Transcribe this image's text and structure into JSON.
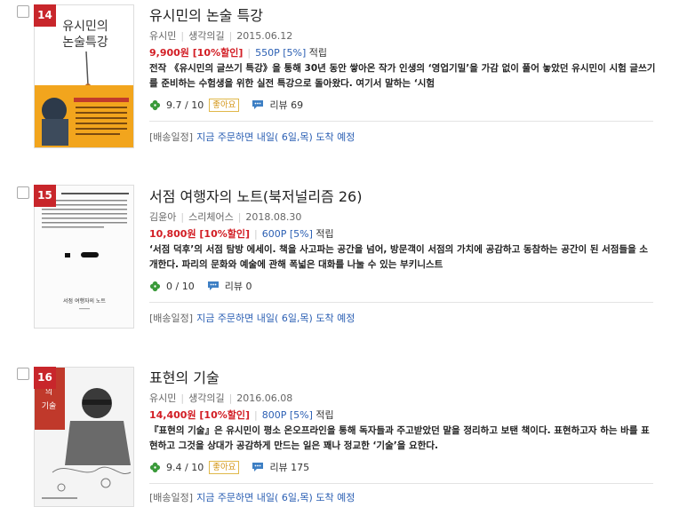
{
  "items": [
    {
      "rank": "14",
      "title": "유시민의 논술 특강",
      "author": "유시민",
      "publisher": "생각의길",
      "date": "2015.06.12",
      "price": "9,900원 [10%할인]",
      "points": "550P [5%]",
      "earn": "적립",
      "desc": "전작 《유시민의 글쓰기 특강》을 통해 30년 동안 쌓아온 작가 인생의 ‘영업기밀’을 가감 없이 풀어 놓았던 유시민이 시험 글쓰기를 준비하는 수험생을 위한 실전 특강으로 돌아왔다. 여기서 말하는 ‘시험",
      "rating": "9.7 / 10",
      "badge": "좋아요",
      "review": "리뷰 69",
      "ship_label": "[배송일정]",
      "ship_msg": "지금 주문하면 내일( 6일,목) 도착 예정",
      "cover": {
        "title": "유시민의 논술특강",
        "band": "혼자서도 할 수 있다!"
      }
    },
    {
      "rank": "15",
      "title": "서점 여행자의 노트(북저널리즘 26)",
      "author": "김윤아",
      "publisher": "스리체어스",
      "date": "2018.08.30",
      "price": "10,800원 [10%할인]",
      "points": "600P [5%]",
      "earn": "적립",
      "desc": "‘서점 덕후’의 서점 탐방 에세이. 책을 사고파는 공간을 넘어, 방문객이 서점의 가치에 공감하고 동참하는 공간이 된 서점들을 소개한다. 파리의 문화와 예술에 관해 폭넓은 대화를 나눌 수 있는 부키니스트",
      "rating": "0 / 10",
      "review": "리뷰 0",
      "ship_label": "[배송일정]",
      "ship_msg": "지금 주문하면 내일( 6일,목) 도착 예정",
      "cover": {
        "title": "서점 여행자의 노트"
      }
    },
    {
      "rank": "16",
      "title": "표현의 기술",
      "author": "유시민",
      "publisher": "생각의길",
      "date": "2016.06.08",
      "price": "14,400원 [10%할인]",
      "points": "800P [5%]",
      "earn": "적립",
      "desc": "『표현의 기술』은 유시민이 평소 온오프라인을 통해 독자들과 주고받았던 말을 정리하고 보탠 책이다. 표현하고자 하는 바를 표현하고 그것을 상대가 공감하게 만드는 일은 꽤나 정교한 ‘기술’을 요한다.",
      "rating": "9.4 / 10",
      "badge": "좋아요",
      "review": "리뷰 175",
      "ship_label": "[배송일정]",
      "ship_msg": "지금 주문하면 내일( 6일,목) 도착 예정",
      "cover": {
        "title": "유시민의 표현의 기술"
      }
    }
  ]
}
